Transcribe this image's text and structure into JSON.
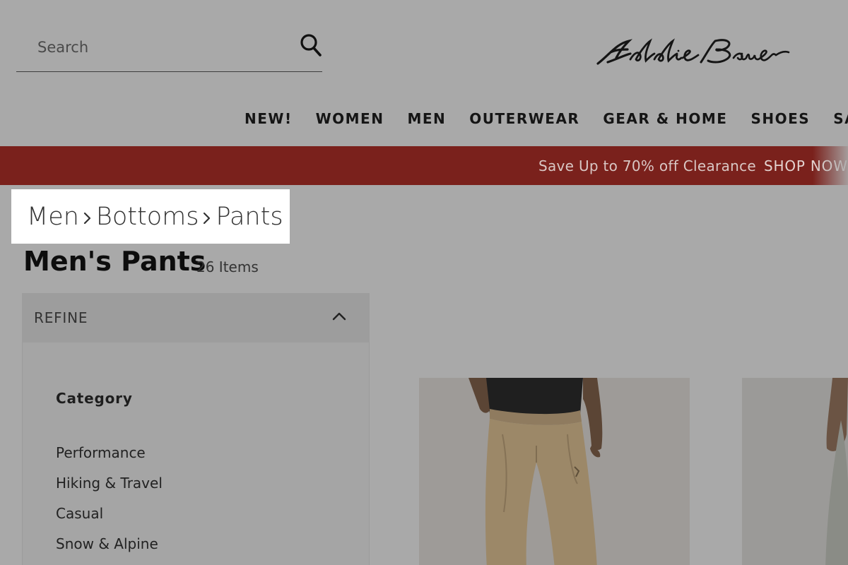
{
  "search": {
    "placeholder": "Search"
  },
  "brand": {
    "logo_text": "Eddie Bauer"
  },
  "nav": {
    "items": [
      "NEW!",
      "WOMEN",
      "MEN",
      "OUTERWEAR",
      "GEAR & HOME",
      "SHOES",
      "SALE"
    ]
  },
  "promo": {
    "text": "Save Up to 70% off Clearance",
    "link": "SHOP NOW",
    "background_color": "#7a211c"
  },
  "breadcrumb": {
    "items": [
      "Men",
      "Bottoms",
      "Pants"
    ]
  },
  "page": {
    "title": "Men's Pants",
    "count": "26 Items"
  },
  "refine": {
    "label": "REFINE",
    "category_heading": "Category",
    "categories": [
      "Performance",
      "Hiking & Travel",
      "Casual",
      "Snow & Alpine"
    ]
  },
  "icons": {
    "search": "search-icon",
    "chevron": "chevron-up-icon",
    "breadcrumb_separator": "chevron-right-icon"
  }
}
